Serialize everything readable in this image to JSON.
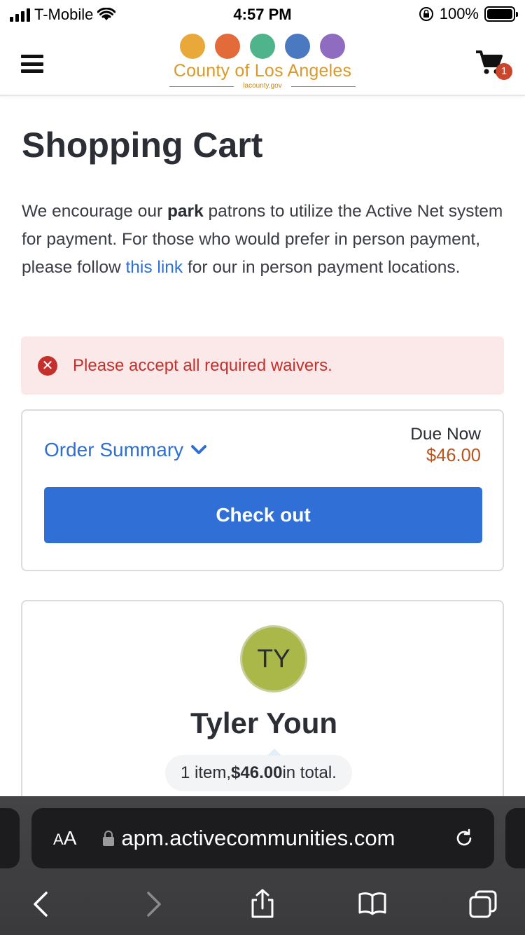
{
  "status_bar": {
    "carrier": "T-Mobile",
    "time": "4:57 PM",
    "battery": "100%"
  },
  "header": {
    "logo": {
      "name": "County of Los Angeles",
      "url": "lacounty.gov",
      "circle_colors": [
        "#e9a93a",
        "#e36b3a",
        "#4fb38b",
        "#4a79c2",
        "#8f6cbf"
      ]
    },
    "cart_count": "1"
  },
  "page": {
    "title": "Shopping Cart",
    "intro": {
      "part1": "We encourage our ",
      "bold": "park",
      "part2": " patrons to utilize the Active Net system for payment. For those who would prefer in person payment, please follow ",
      "link": "this link",
      "part3": " for our in person payment locations."
    },
    "alert": {
      "icon": "error-x-icon",
      "text": "Please accept all required waivers."
    }
  },
  "summary": {
    "toggle_label": "Order Summary",
    "due_label": "Due Now",
    "due_amount": "$46.00",
    "checkout_label": "Check out"
  },
  "customer": {
    "initials": "TY",
    "name": "Tyler Youn",
    "total": {
      "prefix": "1 item, ",
      "amount": "$46.00",
      "suffix": " in total."
    }
  },
  "browser": {
    "aa": "A",
    "aa_small": "A",
    "url": "apm.activecommunities.com"
  },
  "colors": {
    "accent": "#2f6fd6",
    "link": "#2f6fcf",
    "error": "#c4302c",
    "due_amount": "#b8551f",
    "avatar": "#aab84a"
  }
}
